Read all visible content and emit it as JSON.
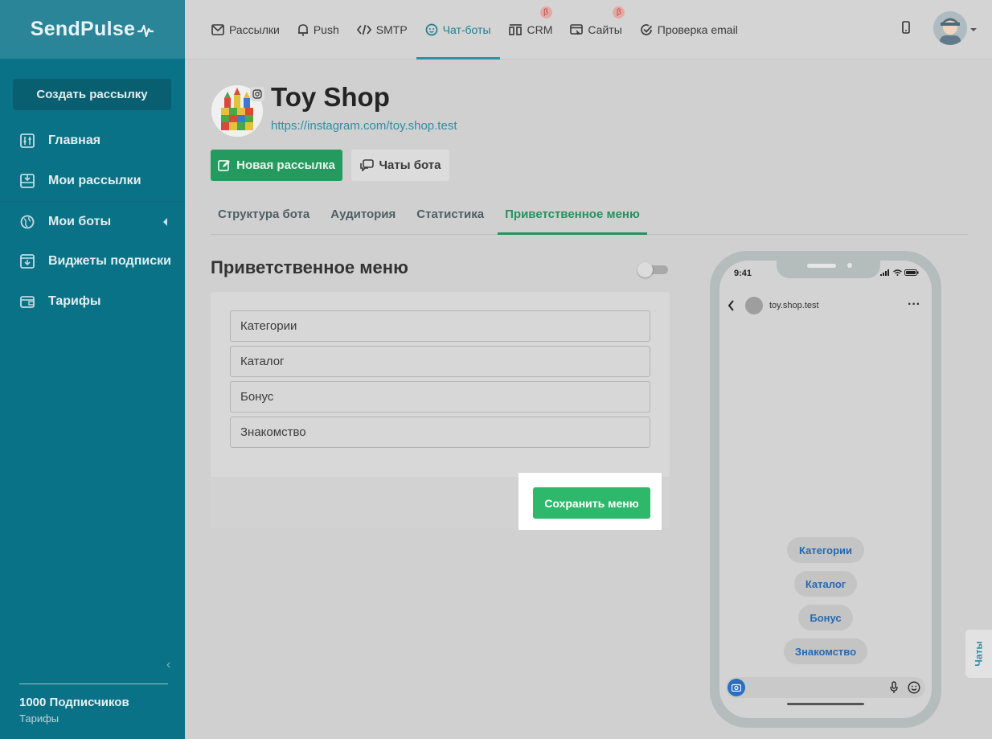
{
  "brand": {
    "name": "SendPulse"
  },
  "sidebar": {
    "create_label": "Создать рассылку",
    "items": [
      {
        "label": "Главная",
        "icon": "sliders-icon"
      },
      {
        "label": "Мои рассылки",
        "icon": "inbox-icon"
      },
      {
        "label": "Мои боты",
        "icon": "globe-icon"
      },
      {
        "label": "Виджеты подписки",
        "icon": "widget-icon"
      },
      {
        "label": "Тарифы",
        "icon": "wallet-icon"
      }
    ],
    "subscribers": "1000 Подписчиков",
    "plan_link": "Тарифы"
  },
  "topnav": {
    "items": [
      {
        "label": "Рассылки",
        "icon": "mail-icon"
      },
      {
        "label": "Push",
        "icon": "bell-icon"
      },
      {
        "label": "SMTP",
        "icon": "code-icon"
      },
      {
        "label": "Чат-боты",
        "icon": "chatbot-icon",
        "active": true
      },
      {
        "label": "CRM",
        "icon": "crm-icon",
        "badge": "β"
      },
      {
        "label": "Сайты",
        "icon": "sites-icon",
        "badge": "β"
      },
      {
        "label": "Проверка email",
        "icon": "check-circle-icon"
      }
    ]
  },
  "bot": {
    "name": "Toy Shop",
    "link": "https://instagram.com/toy.shop.test",
    "new_campaign_label": "Новая рассылка",
    "bot_chats_label": "Чаты бота"
  },
  "tabs": [
    {
      "label": "Структура бота"
    },
    {
      "label": "Аудитория"
    },
    {
      "label": "Статистика"
    },
    {
      "label": "Приветственное меню",
      "active": true
    }
  ],
  "welcome_menu": {
    "title": "Приветственное меню",
    "enabled": false,
    "items": [
      "Категории",
      "Каталог",
      "Бонус",
      "Знакомство"
    ],
    "save_label": "Сохранить меню"
  },
  "phone_preview": {
    "time": "9:41",
    "account": "toy.shop.test",
    "quick_replies": [
      "Категории",
      "Каталог",
      "Бонус",
      "Знакомство"
    ]
  },
  "chats_tab": {
    "label": "Чаты"
  },
  "colors": {
    "sidebar": "#0a7286",
    "accent_green": "#2eb86b",
    "active_blue": "#2a93a3"
  }
}
